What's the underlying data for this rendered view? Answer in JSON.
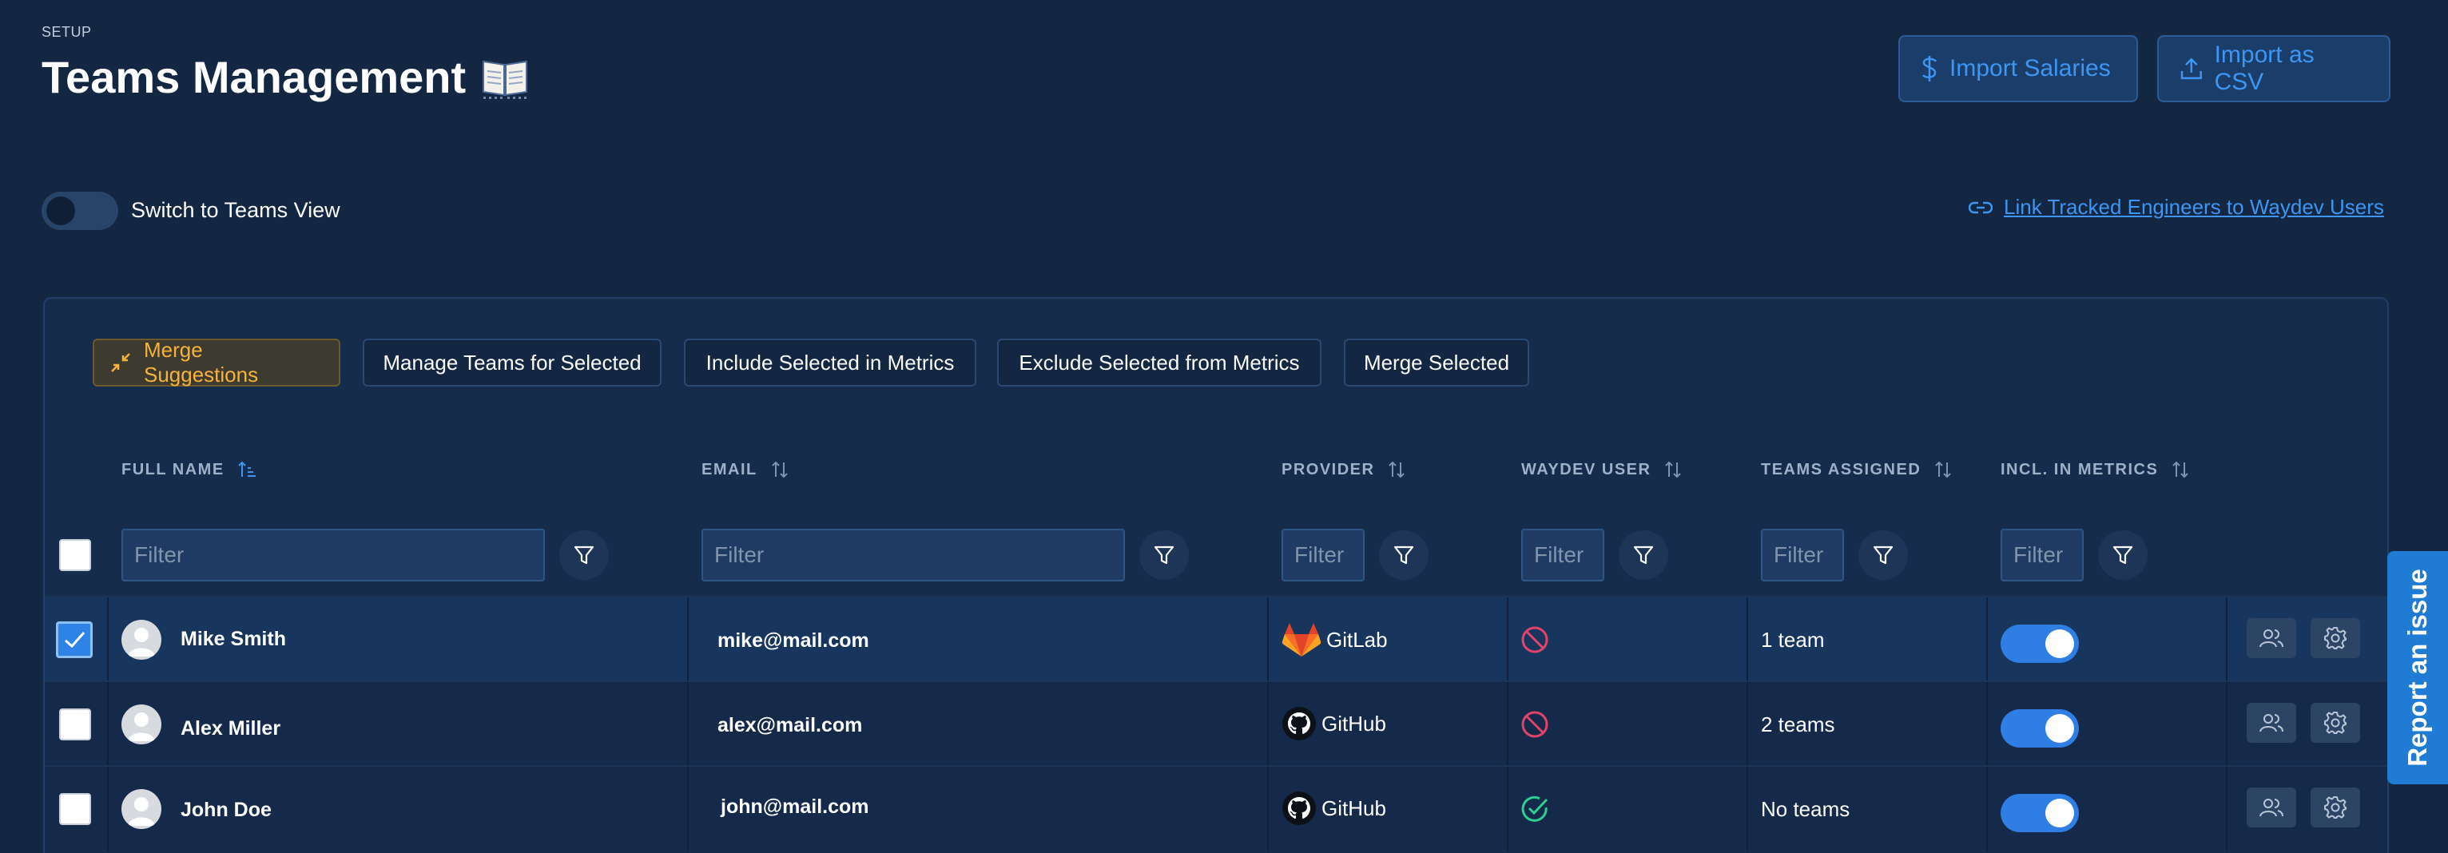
{
  "header": {
    "section_label": "SETUP",
    "title": "Teams Management",
    "title_icon": "open-book-icon",
    "import_salaries_label": "Import Salaries",
    "import_csv_label": "Import as CSV"
  },
  "view_toggle": {
    "label": "Switch to Teams View",
    "on": false
  },
  "link_engineers": {
    "label": "Link Tracked Engineers to Waydev Users",
    "icon": "link-icon"
  },
  "actions": {
    "merge_suggestions": "Merge Suggestions",
    "manage_teams": "Manage Teams for Selected",
    "include_selected": "Include Selected in Metrics",
    "exclude_selected": "Exclude Selected from Metrics",
    "merge_selected": "Merge Selected"
  },
  "columns": {
    "full_name": "FULL NAME",
    "email": "EMAIL",
    "provider": "PROVIDER",
    "waydev_user": "WAYDEV USER",
    "teams_assigned": "TEAMS ASSIGNED",
    "incl_metrics": "INCL. IN METRICS"
  },
  "filter_placeholder": "Filter",
  "rows": [
    {
      "name": "Mike Smith",
      "email": "mike@mail.com",
      "provider": "GitLab",
      "waydev_user": false,
      "teams": "1 team",
      "in_metrics": true,
      "selected": true
    },
    {
      "name": "Alex Miller",
      "email": "alex@mail.com",
      "provider": "GitHub",
      "waydev_user": false,
      "teams": "2 teams",
      "in_metrics": true,
      "selected": false
    },
    {
      "name": "John Doe",
      "email": "john@mail.com",
      "provider": "GitHub",
      "waydev_user": true,
      "teams": "No teams",
      "in_metrics": true,
      "selected": false
    }
  ],
  "report_issue_label": "Report an issue",
  "colors": {
    "background": "#132642",
    "accent_blue": "#3e95f2",
    "merge_orange": "#f6b23c",
    "toggle_on": "#2f7ee3",
    "not_user_red": "#e0446a",
    "is_user_green": "#2fcf8f"
  }
}
